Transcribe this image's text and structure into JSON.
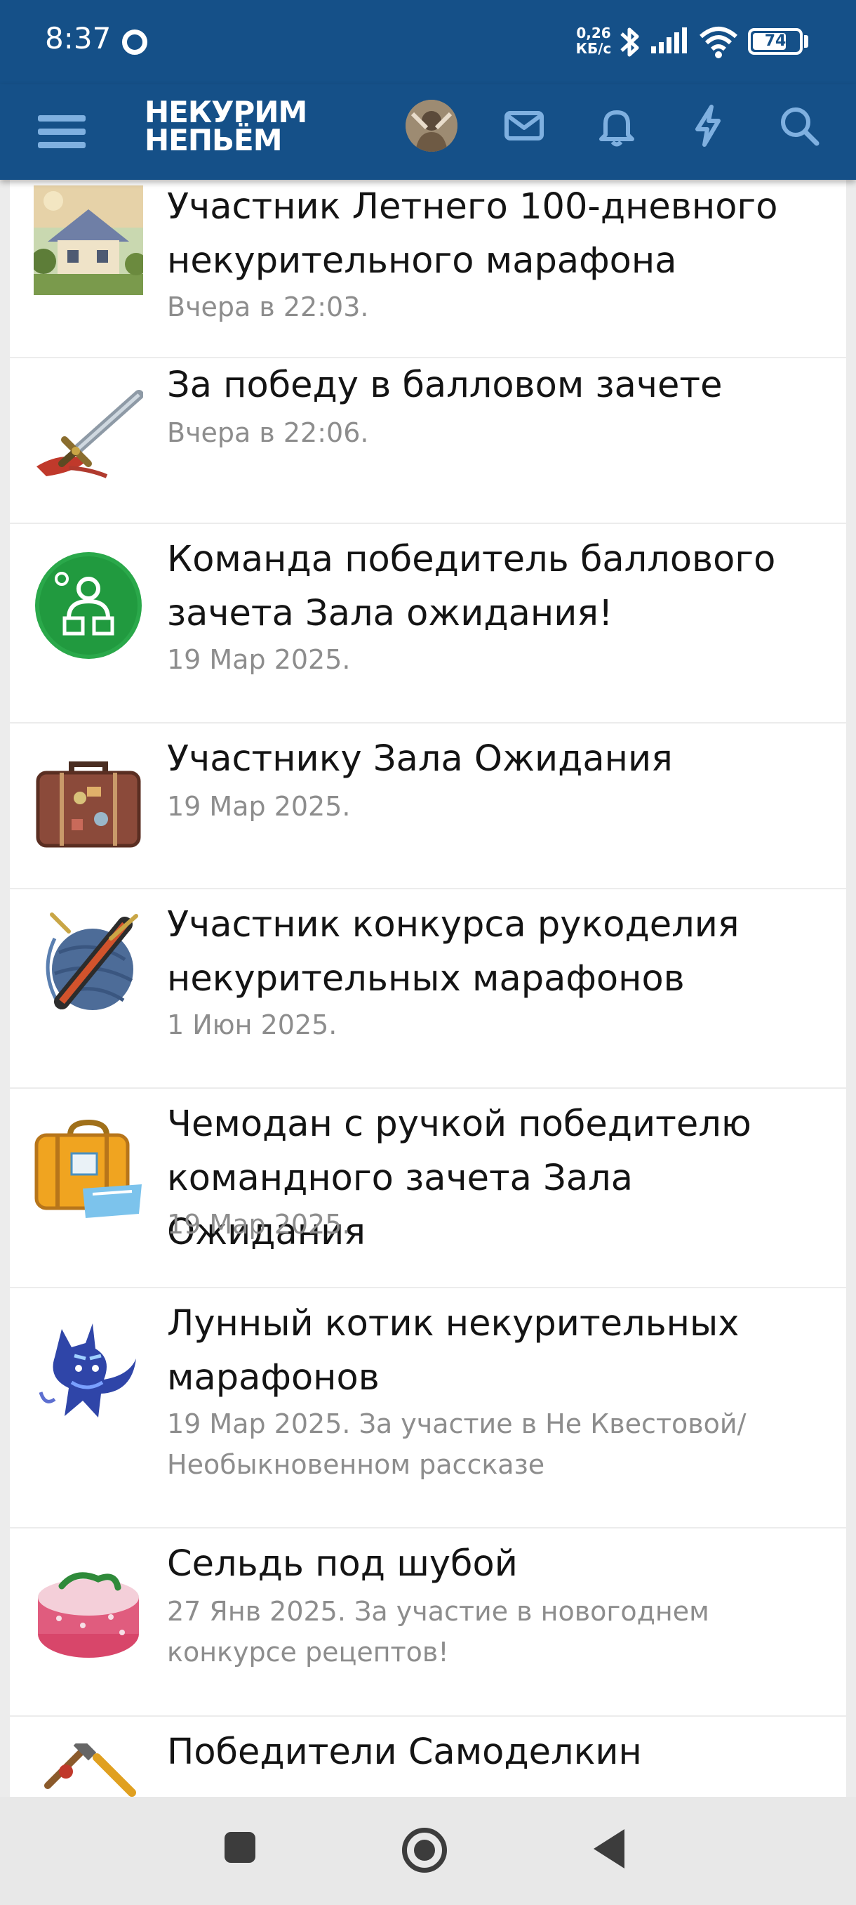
{
  "status_bar": {
    "time": "8:37",
    "speed_value": "0,26",
    "speed_unit": "КБ/с",
    "battery": "74",
    "battery_level": 0.74
  },
  "app_bar": {
    "logo_line1": "НЕКУРИМ",
    "logo_line2": "НЕПЬЁМ",
    "icons": [
      "menu-icon",
      "avatar",
      "mail-icon",
      "bell-icon",
      "lightning-icon",
      "search-icon"
    ],
    "accent_color": "#155088"
  },
  "awards": [
    {
      "title_lines": [
        "Участник Летнего 100-дневного",
        "некурительного марафона"
      ],
      "meta_lines": [
        "Вчера в 22:03."
      ],
      "icon": "cottage-picture-icon"
    },
    {
      "title_lines": [
        "За победу в балловом зачете"
      ],
      "meta_lines": [
        "Вчера в 22:06."
      ],
      "icon": "sword-icon"
    },
    {
      "title_lines": [
        "Команда победитель баллового",
        "зачета Зала ожидания!"
      ],
      "meta_lines": [
        "19 Мар 2025."
      ],
      "icon": "green-team-badge-icon"
    },
    {
      "title_lines": [
        "Участнику Зала Ожидания"
      ],
      "meta_lines": [
        "19 Мар 2025."
      ],
      "icon": "suitcase-icon"
    },
    {
      "title_lines": [
        "Участник конкурса рукоделия",
        "некурительных марафонов"
      ],
      "meta_lines": [
        "1 Июн 2025."
      ],
      "icon": "yarn-ball-icon"
    },
    {
      "title_lines": [
        "Чемодан с ручкой победителю",
        "командного зачета Зала Ожидания"
      ],
      "meta_lines": [
        "19 Мар 2025."
      ],
      "icon": "yellow-suitcase-icon"
    },
    {
      "title_lines": [
        "Лунный котик некурительных",
        "марафонов"
      ],
      "meta_lines": [
        "19 Мар 2025. За участие в Не Квестовой/",
        "Необыкновенном рассказе"
      ],
      "icon": "moon-cat-icon"
    },
    {
      "title_lines": [
        "Сельдь под шубой"
      ],
      "meta_lines": [
        "27 Янв 2025. За участие в новогоднем",
        "конкурсе рецептов!"
      ],
      "icon": "herring-salad-icon"
    },
    {
      "title_lines": [
        "Победители Самоделкин"
      ],
      "meta_lines": [],
      "icon": "tools-icon"
    }
  ],
  "nav_bar": [
    "recents-button",
    "home-button",
    "back-button"
  ]
}
